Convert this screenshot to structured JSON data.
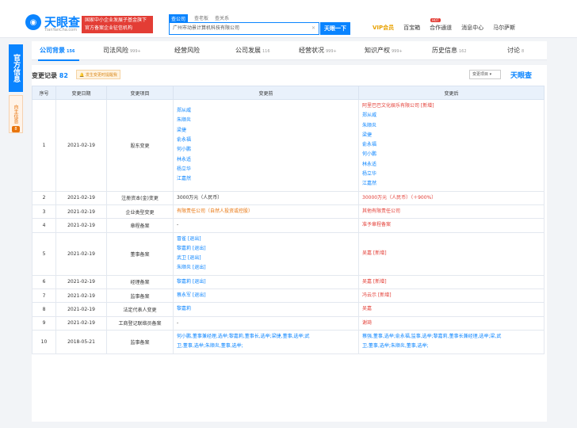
{
  "header": {
    "logo_text": "天眼查",
    "logo_sub": "TianYanCha.com",
    "promo_line1": "国家中小企业发展子基金旗下",
    "promo_line2": "官方备案企业征信机构",
    "search_tabs": [
      "查公司",
      "查老板",
      "查关系"
    ],
    "search_value": "广州市动景计算机科技有限公司",
    "search_button": "天眼一下",
    "vip": "VIP会员",
    "hot": "HOT",
    "nav": [
      "百宝箱",
      "合作通道",
      "消息中心",
      "马尔萨斯"
    ]
  },
  "sidebar": {
    "official": "官方信息",
    "self": "自主信息",
    "badge": "8"
  },
  "tabs": [
    {
      "label": "公司背景",
      "count": "156"
    },
    {
      "label": "司法风险",
      "count": "999+"
    },
    {
      "label": "经营风险",
      "count": ""
    },
    {
      "label": "公司发展",
      "count": "116"
    },
    {
      "label": "经营状况",
      "count": "999+"
    },
    {
      "label": "知识产权",
      "count": "999+"
    },
    {
      "label": "历史信息",
      "count": "162"
    },
    {
      "label": "讨论",
      "count": "8"
    }
  ],
  "section": {
    "title": "变更记录",
    "count": "82",
    "warn": "发生变更时提醒我",
    "select": "变更项目",
    "brand": "天眼查"
  },
  "table": {
    "headers": [
      "序号",
      "变更日期",
      "变更项目",
      "变更前",
      "变更后"
    ],
    "rows": [
      {
        "no": "1",
        "date": "2021-02-19",
        "item": "股东变更",
        "before": [
          {
            "t": "郑从威",
            "s": "lnk"
          },
          {
            "t": "朱顺炎",
            "s": "lnk"
          },
          {
            "t": "梁捷",
            "s": "lnk"
          },
          {
            "t": "俞永福",
            "s": "lnk"
          },
          {
            "t": "何小鹏",
            "s": "lnk"
          },
          {
            "t": "林永适",
            "s": "lnk"
          },
          {
            "t": "杨立华",
            "s": "lnk"
          },
          {
            "t": "江嘉然",
            "s": "lnk"
          }
        ],
        "after": [
          {
            "t": "阿里巴巴文化娱乐有限公司 [新增]",
            "s": "red"
          },
          {
            "t": "郑从威",
            "s": "lnk"
          },
          {
            "t": "朱顺炎",
            "s": "lnk"
          },
          {
            "t": "梁捷",
            "s": "lnk"
          },
          {
            "t": "俞永福",
            "s": "lnk"
          },
          {
            "t": "何小鹏",
            "s": "lnk"
          },
          {
            "t": "林永适",
            "s": "lnk"
          },
          {
            "t": "杨立华",
            "s": "lnk"
          },
          {
            "t": "江嘉然",
            "s": "lnk"
          }
        ]
      },
      {
        "no": "2",
        "date": "2021-02-19",
        "item": "注册资本(金)变更",
        "before": [
          {
            "t": "3000万元（人民币）",
            "s": ""
          }
        ],
        "after": [
          {
            "t": "30000万元（人民币）（＋900%）",
            "s": "red"
          }
        ]
      },
      {
        "no": "3",
        "date": "2021-02-19",
        "item": "企业类型变更",
        "before": [
          {
            "t": "有限责任公司（自然人投资或控股）",
            "s": "mix"
          }
        ],
        "after": [
          {
            "t": "其他有限责任公司",
            "s": "mix2"
          }
        ]
      },
      {
        "no": "4",
        "date": "2021-02-19",
        "item": "章程备案",
        "before": [
          {
            "t": "-",
            "s": ""
          }
        ],
        "after": [
          {
            "t": "准予章程备案",
            "s": "red"
          }
        ]
      },
      {
        "no": "5",
        "date": "2021-02-19",
        "item": "董事备案",
        "before": [
          {
            "t": "冒雀 [退出]",
            "s": "lnk"
          },
          {
            "t": "黎嘉莉 [退出]",
            "s": "lnk"
          },
          {
            "t": "武卫 [退出]",
            "s": "lnk"
          },
          {
            "t": "朱顺炎 [退出]",
            "s": "lnk"
          }
        ],
        "after": [
          {
            "t": "吴嘉 [新增]",
            "s": "red"
          }
        ]
      },
      {
        "no": "6",
        "date": "2021-02-19",
        "item": "经理备案",
        "before": [
          {
            "t": "黎嘉莉 [退出]",
            "s": "lnk"
          }
        ],
        "after": [
          {
            "t": "吴嘉 [新增]",
            "s": "red"
          }
        ]
      },
      {
        "no": "7",
        "date": "2021-02-19",
        "item": "监事备案",
        "before": [
          {
            "t": "蔡永军 [退出]",
            "s": "lnk"
          }
        ],
        "after": [
          {
            "t": "冯云示 [新增]",
            "s": "red"
          }
        ]
      },
      {
        "no": "8",
        "date": "2021-02-19",
        "item": "法定代表人变更",
        "before": [
          {
            "t": "黎嘉莉",
            "s": "lnk"
          }
        ],
        "after": [
          {
            "t": "吴嘉",
            "s": "red"
          }
        ]
      },
      {
        "no": "9",
        "date": "2021-02-19",
        "item": "工商登记联络员备案",
        "before": [
          {
            "t": "-",
            "s": ""
          }
        ],
        "after": [
          {
            "t": "谢琦",
            "s": "red"
          }
        ]
      },
      {
        "no": "10",
        "date": "2018-05-21",
        "item": "监事备案",
        "before": [
          {
            "t": "何小鹏,董事兼经理,选举;黎嘉莉,董事长,选举;梁捷,董事,选举;武",
            "s": "lnk"
          },
          {
            "t": "卫,董事,选举;朱顺炎,董事,选举;",
            "s": "lnk"
          }
        ],
        "after": [
          {
            "t": "蔡强,董事,选举;俞永福,监事,选举;黎嘉莉,董事长兼经理,选举;梁,武",
            "s": "lnk"
          },
          {
            "t": "卫,董事,选举;朱顺炎,董事,选举;",
            "s": "lnk"
          }
        ]
      }
    ]
  }
}
